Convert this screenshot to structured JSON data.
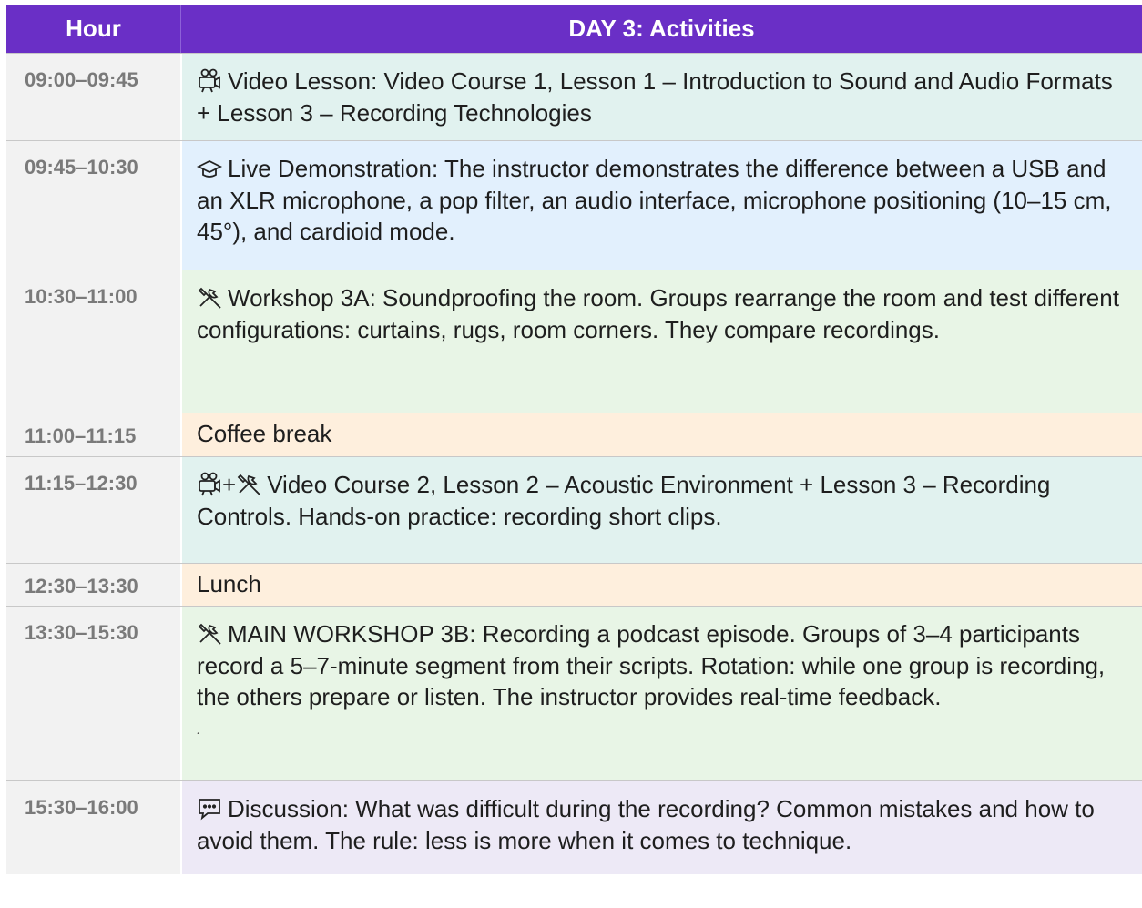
{
  "header": {
    "hour": "Hour",
    "activities": "DAY 3: Activities"
  },
  "rows": [
    {
      "time": "09:00–09:45",
      "icon": "video-camera-icon",
      "text": "Video Lesson: Video Course 1, Lesson 1 – Introduction to Sound and Audio Formats + Lesson 3 – Recording Technologies",
      "bg": "#e1f2ef"
    },
    {
      "time": "09:45–10:30",
      "icon": "graduation-cap-icon",
      "text": "Live Demonstration: The instructor demonstrates the difference between a USB and an XLR microphone, a pop filter, an audio interface, microphone positioning (10–15 cm, 45°), and cardioid mode.",
      "bg": "#e2f0fd"
    },
    {
      "time": "10:30–11:00",
      "icon": "tools-icon",
      "text": "Workshop 3A: Soundproofing the room. Groups rearrange the room and test different configurations: curtains, rugs, room corners. They compare recordings.",
      "bg": "#e8f5e6"
    },
    {
      "time": "11:00–11:15",
      "icon": "",
      "text": "Coffee break",
      "bg": "#feefdd"
    },
    {
      "time": "11:15–12:30",
      "icon": "video-camera-plus-tools-icon",
      "joiner": "+",
      "text": "Video Course 2, Lesson 2 – Acoustic Environment + Lesson 3 – Recording Controls. Hands-on practice: recording short clips.",
      "bg": "#e1f2ef"
    },
    {
      "time": "12:30–13:30",
      "icon": "",
      "text": "Lunch",
      "bg": "#feefdd"
    },
    {
      "time": "13:30–15:30",
      "icon": "tools-icon",
      "text": "MAIN WORKSHOP 3B: Recording a podcast episode. Groups of 3–4 participants record a 5–7-minute segment from their scripts. Rotation: while one group is recording, the others prepare or listen. The instructor provides real-time feedback.",
      "note": ".",
      "bg": "#e8f5e6"
    },
    {
      "time": "15:30–16:00",
      "icon": "chat-bubble-icon",
      "text": "Discussion: What was difficult during the recording? Common mistakes and how to avoid them. The rule: less is more when it comes to technique.",
      "bg": "#ede9f6"
    }
  ]
}
